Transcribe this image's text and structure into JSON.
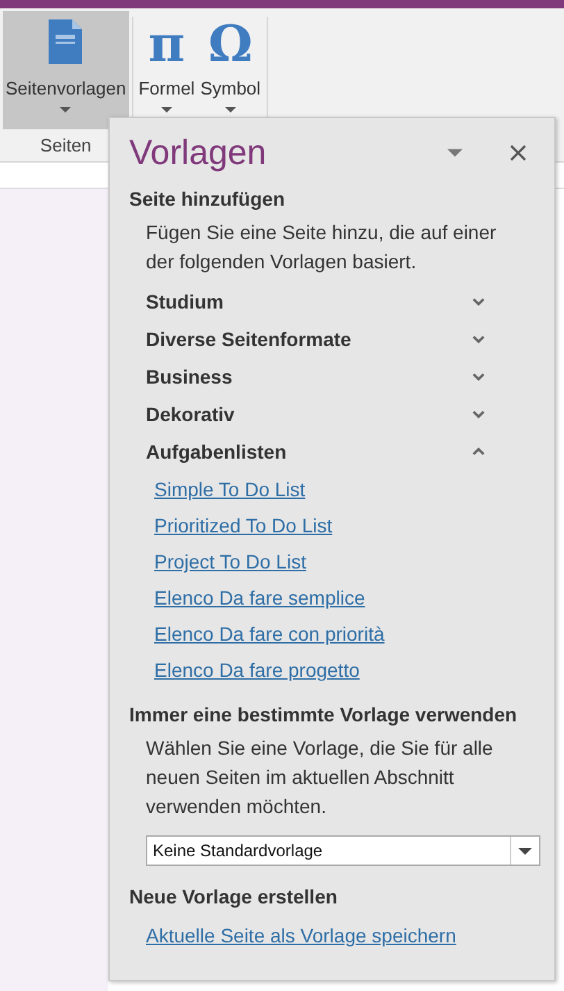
{
  "ribbon": {
    "groups": [
      {
        "label": "Seiten",
        "buttons": [
          {
            "label": "Seitenvorlagen",
            "kind": "page",
            "selected": true
          }
        ]
      },
      {
        "buttons": [
          {
            "label": "Formel",
            "kind": "glyph",
            "glyph": "π",
            "selected": false
          },
          {
            "label": "Symbol",
            "kind": "glyph",
            "glyph": "Ω",
            "selected": false
          }
        ]
      }
    ]
  },
  "panel": {
    "title": "Vorlagen",
    "add_section": {
      "heading": "Seite hinzufügen",
      "description": "Fügen Sie eine Seite hinzu, die auf einer der folgenden Vorlagen basiert.",
      "categories": [
        {
          "label": "Studium",
          "expanded": false
        },
        {
          "label": "Diverse Seitenformate",
          "expanded": false
        },
        {
          "label": "Business",
          "expanded": false
        },
        {
          "label": "Dekorativ",
          "expanded": false
        },
        {
          "label": "Aufgabenlisten",
          "expanded": true,
          "templates": [
            "Simple To Do List",
            "Prioritized To Do List",
            "Project To Do List",
            "Elenco Da fare semplice",
            "Elenco Da fare con priorità",
            "Elenco Da fare progetto"
          ]
        }
      ]
    },
    "default_section": {
      "heading": "Immer eine bestimmte Vorlage verwenden",
      "description": "Wählen Sie eine Vorlage, die Sie für alle neuen Seiten im aktuellen Abschnitt verwenden möchten.",
      "dropdown_value": "Keine Standardvorlage"
    },
    "create_section": {
      "heading": "Neue Vorlage erstellen",
      "link": "Aktuelle Seite als Vorlage speichern"
    }
  }
}
